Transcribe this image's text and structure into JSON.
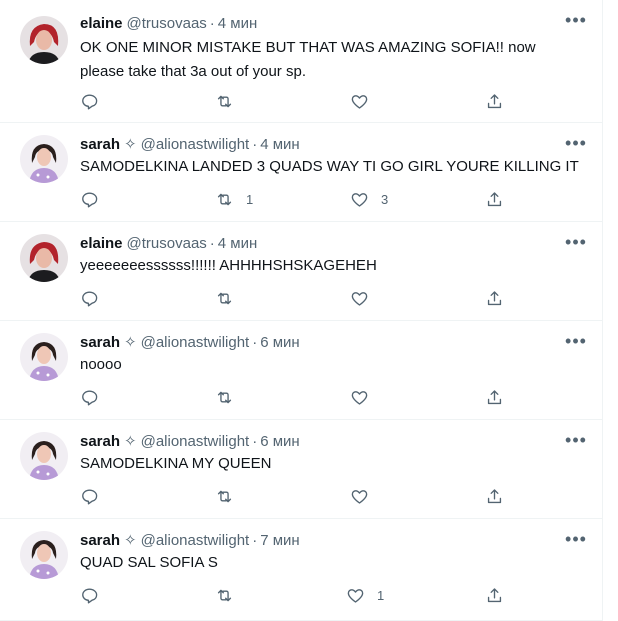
{
  "colors": {
    "text": "#0f1419",
    "secondary": "#536471",
    "border": "#eff3f4"
  },
  "icons": {
    "reply": "reply-icon",
    "retweet": "retweet-icon",
    "like": "heart-icon",
    "share": "share-icon",
    "more": "more-icon"
  },
  "more_label": "•••",
  "tweets": [
    {
      "name": "elaine",
      "badge": "",
      "handle": "@trusovaas",
      "separator": "·",
      "time": "4 мин",
      "text": "OK ONE MINOR MISTAKE BUT THAT WAS AMAZING SOFIA!! now please take that 3a out of your sp.",
      "retweets": "",
      "likes": ""
    },
    {
      "name": "sarah",
      "badge": "✧",
      "handle": "@alionastwilight",
      "separator": "·",
      "time": "4 мин",
      "text": "SAMODELKINA LANDED 3 QUADS WAY TI GO GIRL YOURE KILLING IT",
      "retweets": "1",
      "likes": "3"
    },
    {
      "name": "elaine",
      "badge": "",
      "handle": "@trusovaas",
      "separator": "·",
      "time": "4 мин",
      "text": "yeeeeeeessssss!!!!!! AHHHHSHSKAGEHEH",
      "retweets": "",
      "likes": ""
    },
    {
      "name": "sarah",
      "badge": "✧",
      "handle": "@alionastwilight",
      "separator": "·",
      "time": "6 мин",
      "text": "noooo",
      "retweets": "",
      "likes": ""
    },
    {
      "name": "sarah",
      "badge": "✧",
      "handle": "@alionastwilight",
      "separator": "·",
      "time": "6 мин",
      "text": "SAMODELKINA MY QUEEN",
      "retweets": "",
      "likes": ""
    },
    {
      "name": "sarah",
      "badge": "✧",
      "handle": "@alionastwilight",
      "separator": "·",
      "time": "7 мин",
      "text": "QUAD SAL SOFIA S",
      "retweets": "",
      "likes": "1"
    }
  ]
}
